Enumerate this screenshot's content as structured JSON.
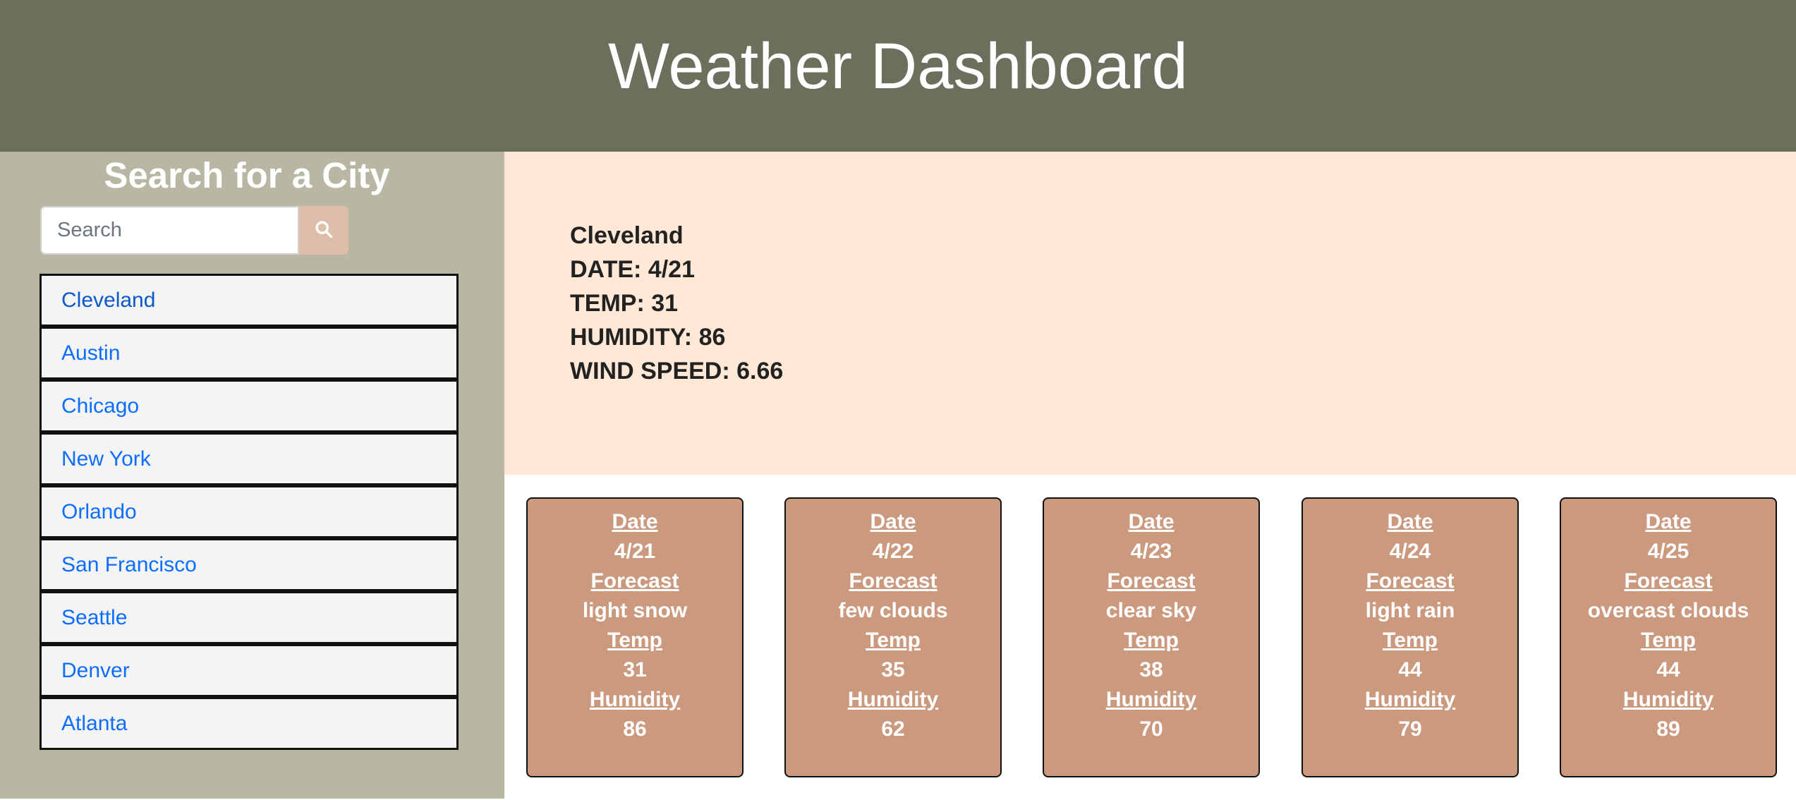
{
  "header": {
    "title": "Weather Dashboard"
  },
  "sidebar": {
    "heading": "Search for a City",
    "search": {
      "placeholder": "Search",
      "value": ""
    },
    "cities": [
      "Cleveland",
      "Austin",
      "Chicago",
      "New York",
      "Orlando",
      "San Francisco",
      "Seattle",
      "Denver",
      "Atlanta"
    ]
  },
  "current": {
    "city": "Cleveland",
    "date": "DATE: 4/21",
    "temp": "TEMP: 31",
    "humidity": "HUMIDITY: 86",
    "wind": "WIND SPEED: 6.66"
  },
  "forecast_labels": {
    "date": "Date",
    "forecast": "Forecast",
    "temp": "Temp",
    "humidity": "Humidity"
  },
  "forecast": [
    {
      "date": "4/21",
      "forecast": "light snow",
      "temp": "31",
      "humidity": "86"
    },
    {
      "date": "4/22",
      "forecast": "few clouds",
      "temp": "35",
      "humidity": "62"
    },
    {
      "date": "4/23",
      "forecast": "clear sky",
      "temp": "38",
      "humidity": "70"
    },
    {
      "date": "4/24",
      "forecast": "light rain",
      "temp": "44",
      "humidity": "79"
    },
    {
      "date": "4/25",
      "forecast": "overcast clouds",
      "temp": "44",
      "humidity": "89"
    }
  ],
  "colors": {
    "header_bg": "#6b705c",
    "sidebar_bg": "#b7b7a4",
    "current_bg": "#ffe8d6",
    "card_bg": "#cb997e",
    "search_btn_bg": "#ddbea9",
    "link": "#0d6efd"
  },
  "icons": {
    "search_button": "search-icon"
  }
}
